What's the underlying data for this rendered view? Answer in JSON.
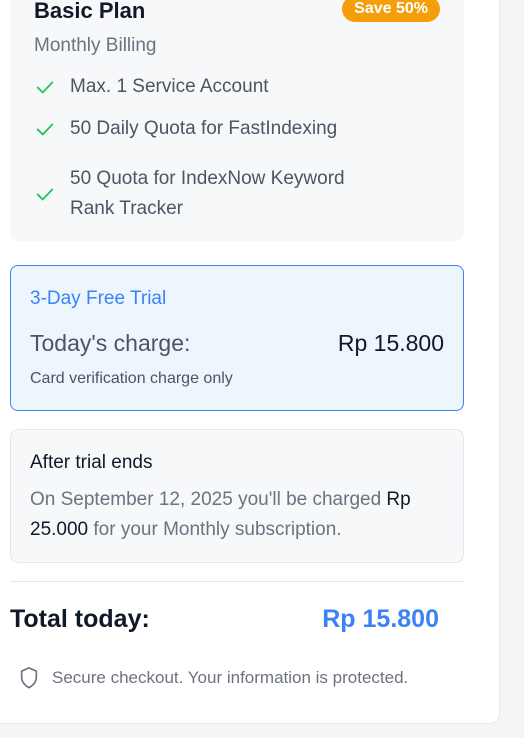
{
  "plan": {
    "name": "Basic Plan",
    "badge": "Save 50%",
    "billing": "Monthly Billing",
    "features": [
      {
        "icon": "check-icon",
        "line1": "Max. 1 Service Account"
      },
      {
        "icon": "check-icon",
        "line1": "50 Daily Quota for FastIndexing"
      },
      {
        "icon": "check-icon",
        "line1": "50 Quota for IndexNow Keyword",
        "line2": "Rank Tracker"
      }
    ]
  },
  "trial": {
    "title": "3-Day Free Trial",
    "charge_label": "Today's charge:",
    "charge_value": "Rp 15.800",
    "note": "Card verification charge only"
  },
  "after_trial": {
    "title": "After trial ends",
    "text_before": "On September 12, 2025 you'll be charged",
    "amount": "Rp 25.000",
    "text_after": " for your Monthly subscription."
  },
  "total": {
    "label": "Total today:",
    "value": "Rp 15.800"
  },
  "secure": {
    "icon": "shield-icon",
    "text": "Secure checkout. Your information is protected."
  },
  "colors": {
    "accent": "#3b82f6",
    "badge": "#f59e0b",
    "check": "#22c55e"
  }
}
